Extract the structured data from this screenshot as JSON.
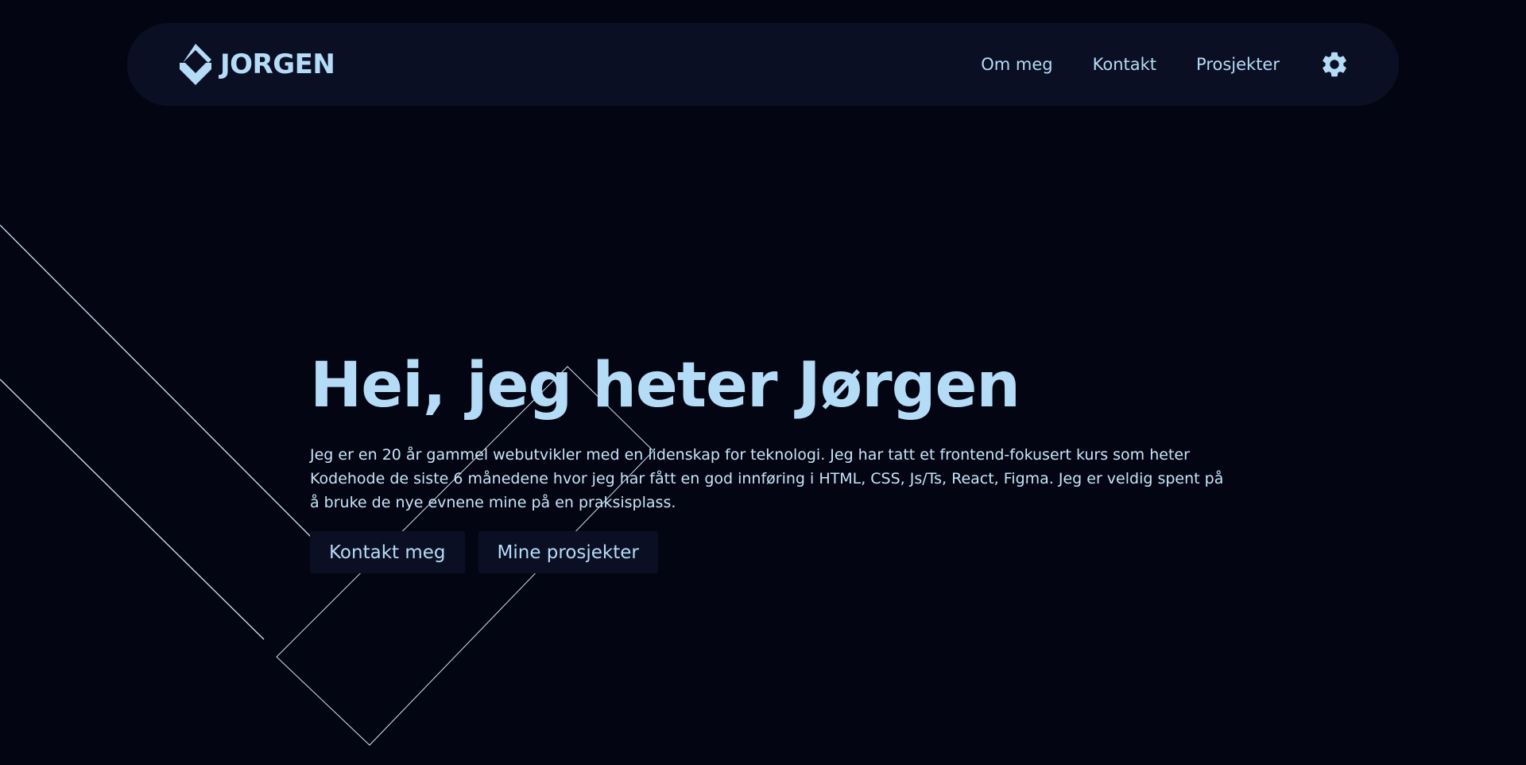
{
  "colors": {
    "background": "#030612",
    "surface": "#0b0f24",
    "accent": "#b5dcf7",
    "text": "#c6e4fa"
  },
  "nav": {
    "logo_text": "JORGEN",
    "logo_icon": "diamond-logo-icon",
    "links": [
      {
        "label": "Om meg"
      },
      {
        "label": "Kontakt"
      },
      {
        "label": "Prosjekter"
      }
    ],
    "settings_icon": "gear-icon"
  },
  "hero": {
    "title": "Hei, jeg heter Jørgen",
    "description": "Jeg er en 20 år gammel webutvikler med en lidenskap for teknologi. Jeg har tatt et frontend-fokusert kurs som heter Kodehode de siste 6 månedene hvor jeg har fått en god innføring i HTML, CSS, Js/Ts, React, Figma. Jeg er veldig spent på å bruke de nye evnene mine på en praksisplass.",
    "buttons": [
      {
        "label": "Kontakt meg"
      },
      {
        "label": "Mine prosjekter"
      }
    ]
  }
}
